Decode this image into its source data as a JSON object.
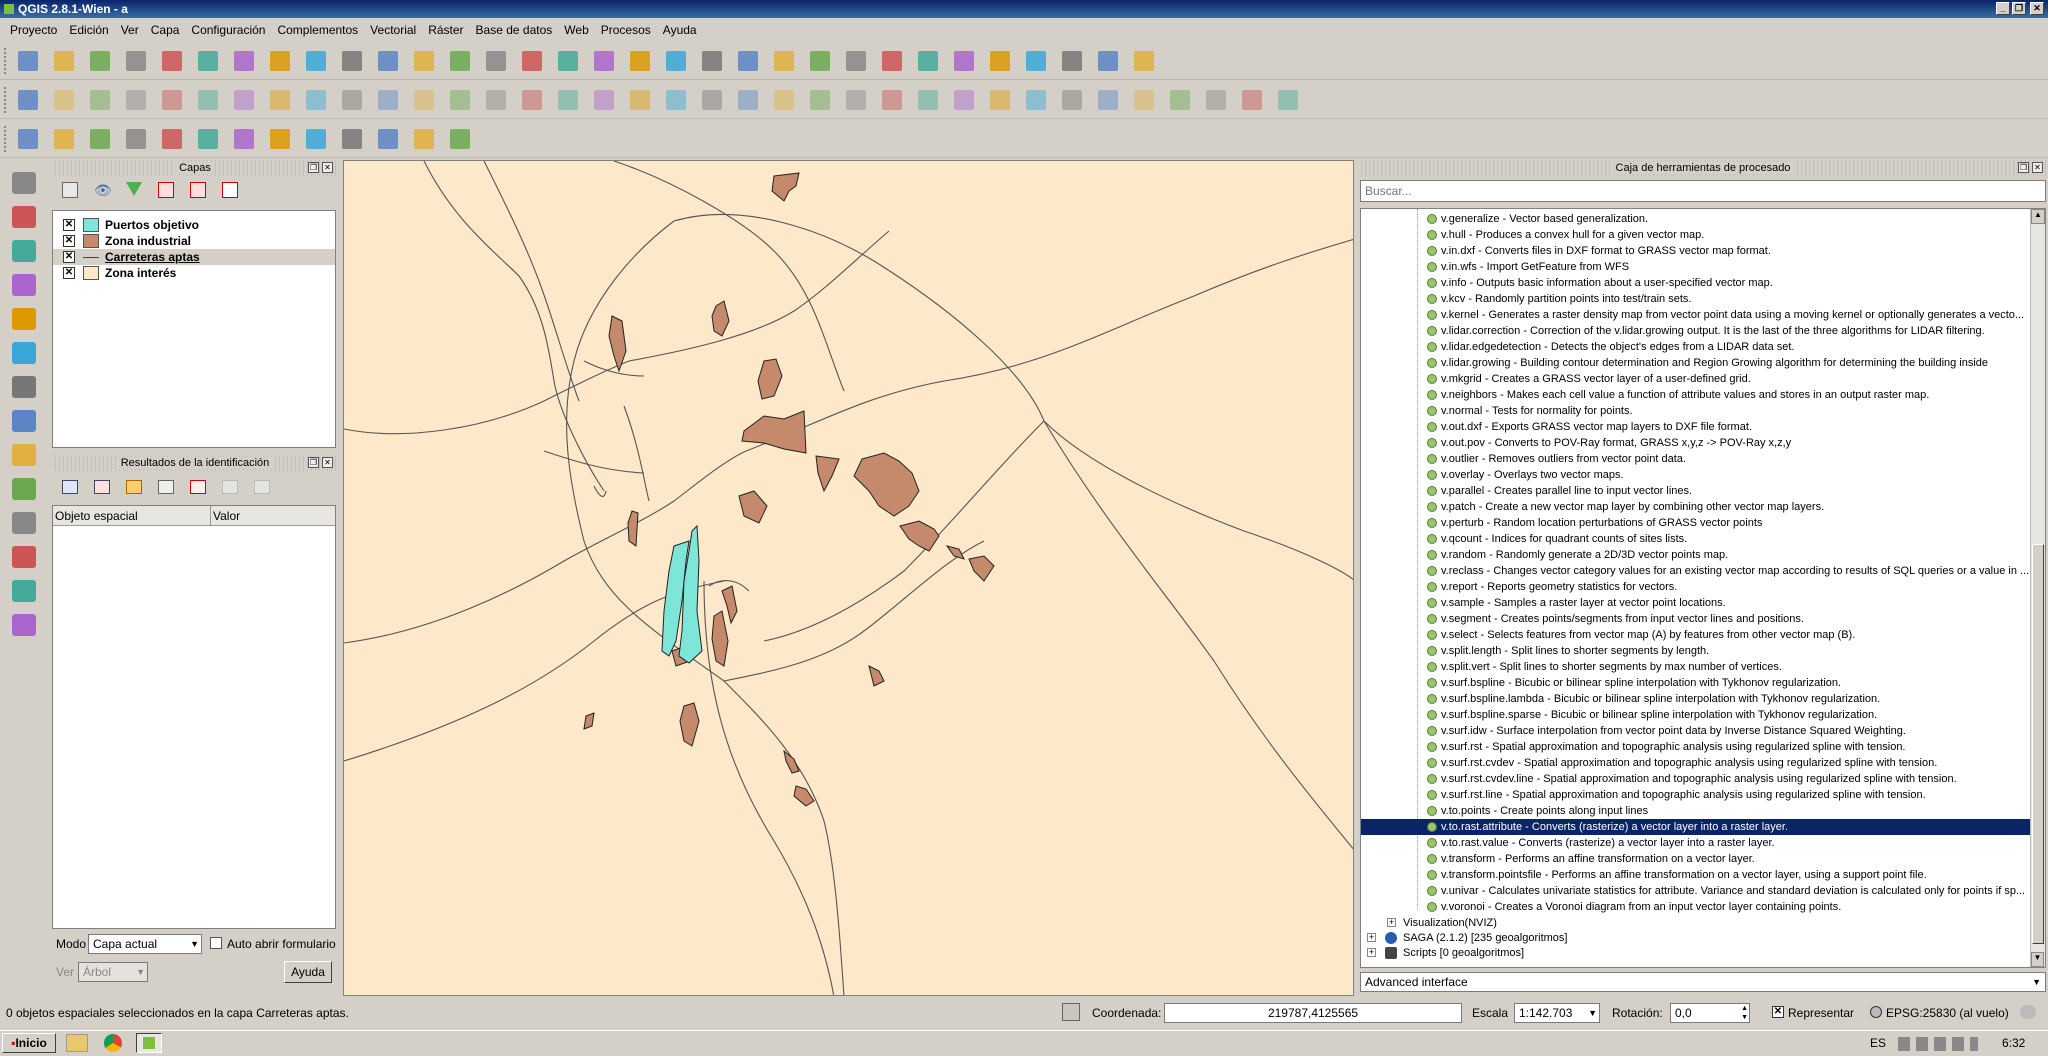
{
  "window": {
    "title": "QGIS 2.8.1-Wien - a"
  },
  "menu": [
    "Proyecto",
    "Edición",
    "Ver",
    "Capa",
    "Configuración",
    "Complementos",
    "Vectorial",
    "Ráster",
    "Base de datos",
    "Web",
    "Procesos",
    "Ayuda"
  ],
  "icons": {
    "toolbar_row1": [
      "new-project-icon",
      "open-project-icon",
      "save-project-icon",
      "save-as-icon",
      "new-print-composer-icon",
      "composer-manager-icon",
      "touch-zoom-icon",
      "pan-icon",
      "pan-to-selection-icon",
      "zoom-in-icon",
      "zoom-out-icon",
      "zoom-actual-size-icon",
      "zoom-full-icon",
      "zoom-to-selection-icon",
      "zoom-to-layer-icon",
      "zoom-last-icon",
      "zoom-next-icon",
      "refresh-icon",
      "identify-icon",
      "actions-icon",
      "select-icon",
      "deselect-icon",
      "expression-select-icon",
      "attribute-table-icon",
      "field-calculator-icon",
      "measure-icon",
      "map-tips-icon",
      "new-bookmark-icon",
      "show-bookmarks-icon",
      "text-annotation-icon",
      "help-icon",
      "whats-this-icon"
    ],
    "toolbar_row2": [
      "current-edits-icon",
      "toggle-editing-icon",
      "save-edits-icon",
      "add-feature-icon",
      "move-feature-icon",
      "node-tool-icon",
      "delete-selected-icon",
      "cut-features-icon",
      "copy-features-icon",
      "paste-features-icon",
      "advanced-digitize-icon",
      "undo-icon",
      "redo-icon",
      "rotate-feature-icon",
      "simplify-feature-icon",
      "add-ring-icon",
      "add-part-icon",
      "fill-ring-icon",
      "delete-ring-icon",
      "delete-part-icon",
      "reshape-icon",
      "offset-curve-icon",
      "split-features-icon",
      "split-parts-icon",
      "merge-features-icon",
      "merge-attributes-icon",
      "rotate-point-symbols-icon",
      "label-icon",
      "label-pin-icon",
      "label-highlight-icon",
      "label-move-icon",
      "label-rotate-icon",
      "label-change-icon",
      "label-show-hide-icon",
      "csw-icon",
      "python-icon"
    ],
    "toolbar_row3": [
      "processing-toolbox-icon",
      "graphical-modeler-icon",
      "history-icon",
      "options-icon",
      "results-viewer-icon",
      "command-icon",
      "commander-icon",
      "sextante-icon",
      "georeferencer-icon",
      "gps-tools-icon",
      "topology-checker-icon",
      "raster-calc-icon",
      "heatmap-icon"
    ],
    "left_tools": [
      "add-vector-layer-icon",
      "add-raster-layer-icon",
      "add-postgis-layer-icon",
      "add-spatialite-layer-icon",
      "add-mssql-layer-icon",
      "add-wms-layer-icon",
      "add-oracle-layer-icon",
      "add-wcs-layer-icon",
      "add-wfs-layer-icon",
      "add-delimited-text-icon",
      "new-shapefile-icon",
      "new-spatialite-icon",
      "new-gpx-icon",
      "add-virtual-layer-icon"
    ]
  },
  "layers_panel": {
    "title": "Capas",
    "layers": [
      {
        "name": "Puertos objetivo",
        "checked": true,
        "swatch": "#7ee6d8",
        "type": "polygon"
      },
      {
        "name": "Zona industrial",
        "checked": true,
        "swatch": "#c58a6b",
        "type": "polygon"
      },
      {
        "name": "Carreteras aptas",
        "checked": true,
        "swatch": "#444444",
        "type": "line"
      },
      {
        "name": "Zona interés",
        "checked": true,
        "swatch": "#fde8c9",
        "type": "polygon"
      }
    ]
  },
  "identify_panel": {
    "title": "Resultados de la identificación",
    "col_feature": "Objeto espacial",
    "col_value": "Valor",
    "mode_label": "Modo",
    "mode_value": "Capa actual",
    "auto_open_label": "Auto abrir formulario",
    "view_label": "Ver",
    "view_value": "Árbol",
    "help_button": "Ayuda"
  },
  "toolbox": {
    "title": "Caja de herramientas de procesado",
    "search_placeholder": "Buscar...",
    "items": [
      "v.generalize - Vector based generalization.",
      "v.hull - Produces a convex hull for a given vector map.",
      "v.in.dxf - Converts files in DXF format to GRASS vector map format.",
      "v.in.wfs - Import GetFeature from WFS",
      "v.info - Outputs basic information about a user-specified vector map.",
      "v.kcv - Randomly partition points into test/train sets.",
      "v.kernel - Generates a raster density map from vector point data using a moving kernel or optionally generates a vecto...",
      "v.lidar.correction - Correction of the v.lidar.growing output. It is the last of the three algorithms for LIDAR filtering.",
      "v.lidar.edgedetection - Detects the object's edges from a LIDAR data set.",
      "v.lidar.growing - Building contour determination and Region Growing algorithm for determining the building inside",
      "v.mkgrid - Creates a GRASS vector layer of a user-defined grid.",
      "v.neighbors - Makes each cell value a function of attribute values and stores in an output raster map.",
      "v.normal - Tests for normality for points.",
      "v.out.dxf - Exports GRASS vector map layers to DXF file format.",
      "v.out.pov - Converts to POV-Ray format, GRASS x,y,z -> POV-Ray x,z,y",
      "v.outlier - Removes outliers from vector point data.",
      "v.overlay - Overlays two vector maps.",
      "v.parallel - Creates parallel line to input vector lines.",
      "v.patch - Create a new vector map layer by combining other vector map layers.",
      "v.perturb - Random location perturbations of GRASS vector points",
      "v.qcount - Indices for quadrant counts of sites lists.",
      "v.random - Randomly generate a 2D/3D vector points map.",
      "v.reclass - Changes vector category values for an existing vector map according to results of SQL queries or a value in ...",
      "v.report - Reports geometry statistics for vectors.",
      "v.sample - Samples a raster layer at vector point locations.",
      "v.segment - Creates points/segments from input vector lines and positions.",
      "v.select - Selects features from vector map (A) by features from other vector map (B).",
      "v.split.length - Split lines to shorter segments by length.",
      "v.split.vert - Split lines to shorter segments by max number of vertices.",
      "v.surf.bspline - Bicubic or bilinear spline interpolation with Tykhonov regularization.",
      "v.surf.bspline.lambda - Bicubic or bilinear spline interpolation with Tykhonov regularization.",
      "v.surf.bspline.sparse - Bicubic or bilinear spline interpolation with Tykhonov regularization.",
      "v.surf.idw - Surface interpolation from vector point data by Inverse Distance Squared Weighting.",
      "v.surf.rst - Spatial approximation and topographic analysis using regularized spline with tension.",
      "v.surf.rst.cvdev - Spatial approximation and topographic analysis using regularized spline with tension.",
      "v.surf.rst.cvdev.line - Spatial approximation and topographic analysis using regularized spline with tension.",
      "v.surf.rst.line - Spatial approximation and topographic analysis using regularized spline with tension.",
      "v.to.points - Create points along input lines",
      "v.to.rast.attribute - Converts (rasterize) a vector layer into a raster layer.",
      "v.to.rast.value - Converts (rasterize) a vector layer into a raster layer.",
      "v.transform - Performs an affine transformation on a vector layer.",
      "v.transform.pointsfile - Performs an affine transformation on a vector layer, using a support point file.",
      "v.univar - Calculates univariate statistics for attribute. Variance and standard deviation is calculated only for points if sp...",
      "v.voronoi - Creates a Voronoi diagram from an input vector layer containing points."
    ],
    "selected_index": 38,
    "groups": [
      "Visualization(NVIZ)",
      "SAGA (2.1.2) [235 geoalgoritmos]",
      "Scripts [0 geoalgoritmos]"
    ],
    "advanced_label": "Advanced interface"
  },
  "status": {
    "message": "0 objetos espaciales seleccionados en la capa Carreteras aptas.",
    "coord_label": "Coordenada:",
    "coord_value": "219787,4125565",
    "scale_label": "Escala",
    "scale_value": "1:142.703",
    "rotation_label": "Rotación:",
    "rotation_value": "0,0",
    "render_label": "Representar",
    "crs_label": "EPSG:25830 (al vuelo)"
  },
  "taskbar": {
    "start": "Inicio",
    "lang": "ES",
    "time": "6:32"
  },
  "colors": {
    "map_bg": "#fde8c9",
    "industrial": "#c58a6b",
    "ports": "#7ee6d8",
    "roads": "#555555",
    "selection": "#0a246a"
  }
}
